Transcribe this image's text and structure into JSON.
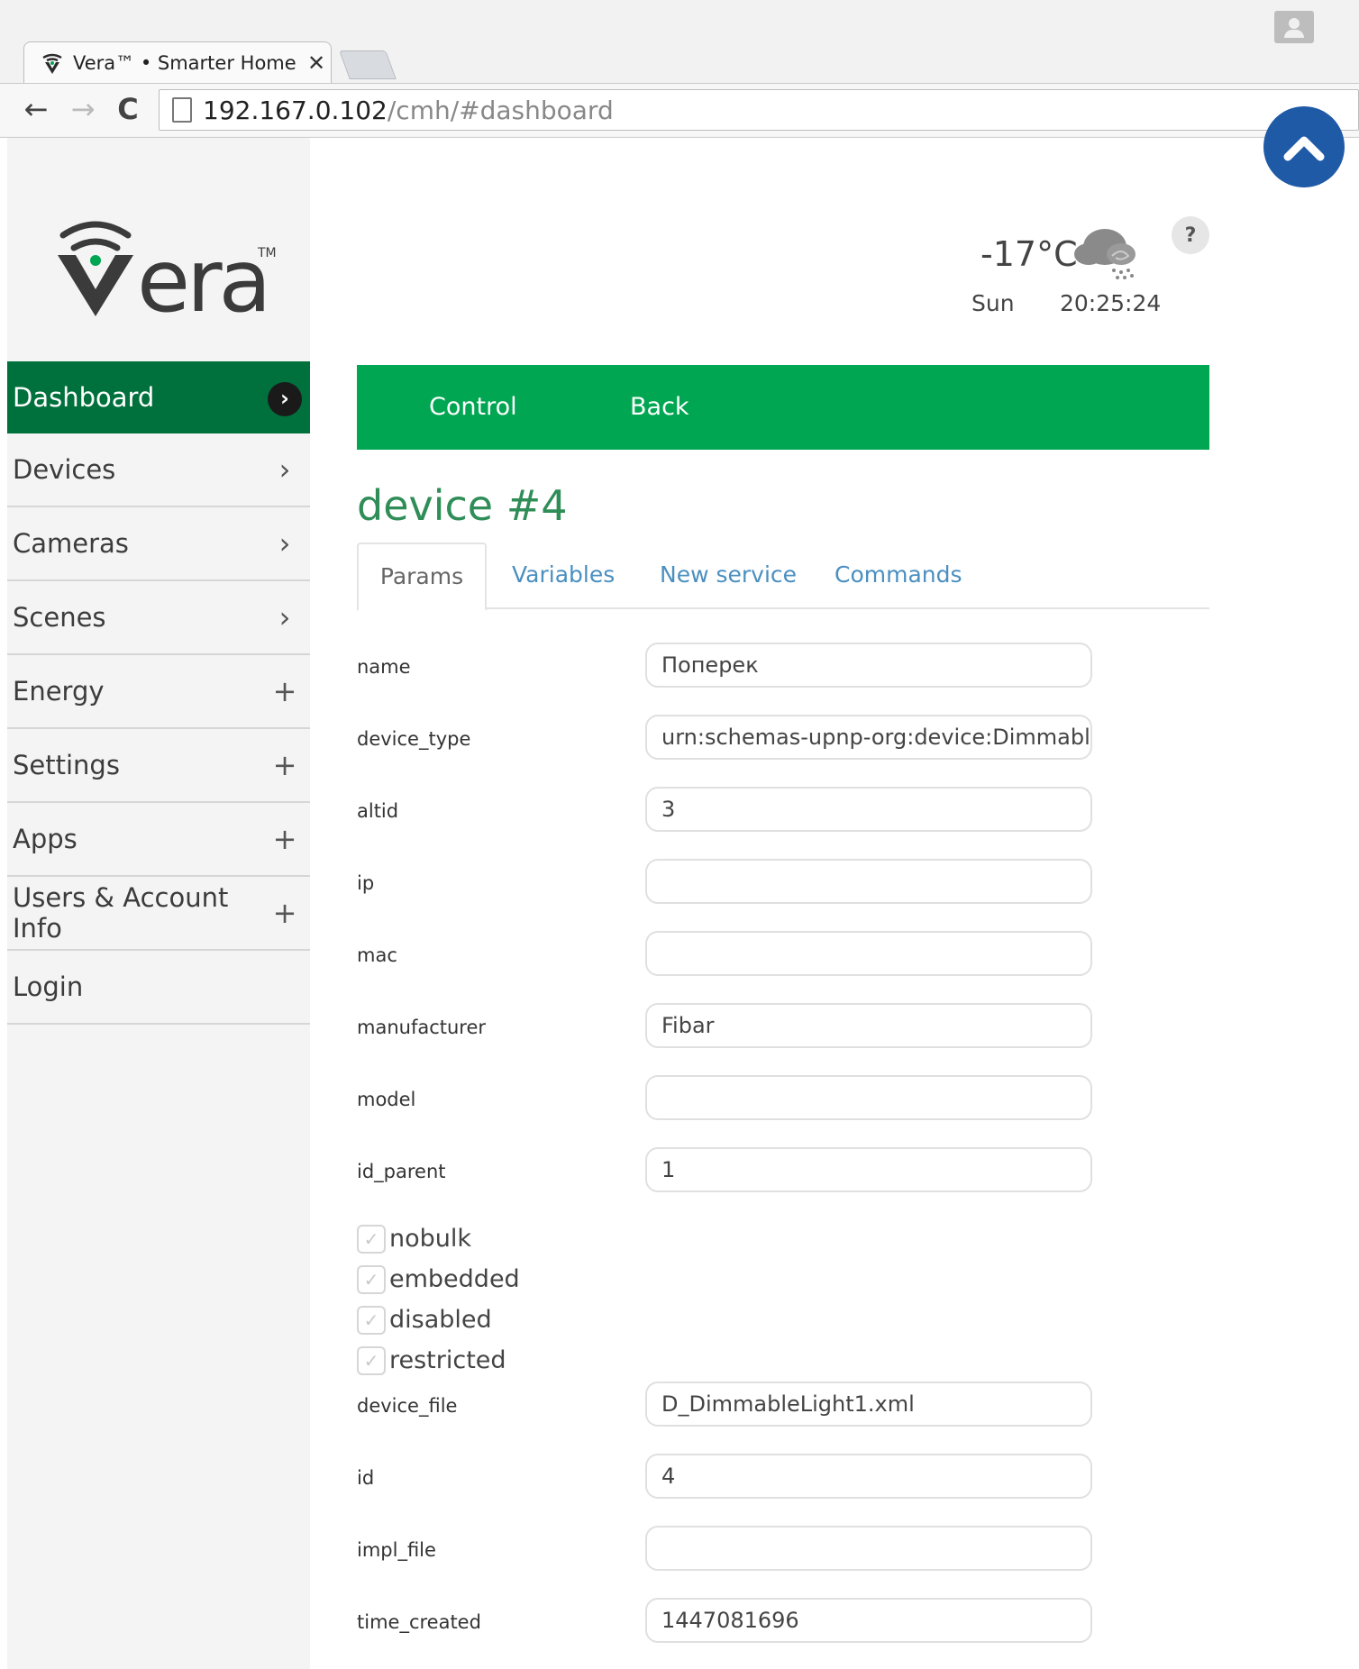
{
  "browser": {
    "tab_title": "Vera™ • Smarter Home C",
    "tab_close": "✕",
    "url_host": "192.167.0.102",
    "url_path": "/cmh/#dashboard"
  },
  "sidebar": {
    "logo_text": "vera",
    "items": [
      {
        "label": "Dashboard",
        "control": "›",
        "icon": "chevron-right-icon",
        "active": true
      },
      {
        "label": "Devices",
        "control": "›",
        "icon": "chevron-right-icon"
      },
      {
        "label": "Cameras",
        "control": "›",
        "icon": "chevron-right-icon"
      },
      {
        "label": "Scenes",
        "control": "›",
        "icon": "chevron-right-icon"
      },
      {
        "label": "Energy",
        "control": "+",
        "icon": "plus-icon"
      },
      {
        "label": "Settings",
        "control": "+",
        "icon": "plus-icon"
      },
      {
        "label": "Apps",
        "control": "+",
        "icon": "plus-icon"
      },
      {
        "label": "Users & Account Info",
        "control": "+",
        "icon": "plus-icon"
      },
      {
        "label": "Login",
        "control": ""
      }
    ]
  },
  "weather": {
    "temperature": "-17°C",
    "day": "Sun",
    "time": "20:25:24",
    "icon": "cloud-snow-icon"
  },
  "help": {
    "label": "?"
  },
  "actions": {
    "control": "Control",
    "back": "Back"
  },
  "device": {
    "title": "device #4"
  },
  "tabs": {
    "params": "Params",
    "variables": "Variables",
    "new_service": "New service",
    "commands": "Commands"
  },
  "params": [
    {
      "label": "name",
      "value": "Поперек"
    },
    {
      "label": "device_type",
      "value": "urn:schemas-upnp-org:device:DimmableLig"
    },
    {
      "label": "altid",
      "value": "3"
    },
    {
      "label": "ip",
      "value": ""
    },
    {
      "label": "mac",
      "value": ""
    },
    {
      "label": "manufacturer",
      "value": "Fibar"
    },
    {
      "label": "model",
      "value": ""
    },
    {
      "label": "id_parent",
      "value": "1"
    }
  ],
  "flags": [
    {
      "label": "nobulk",
      "checked": true
    },
    {
      "label": "embedded",
      "checked": true
    },
    {
      "label": "disabled",
      "checked": true
    },
    {
      "label": "restricted",
      "checked": true
    }
  ],
  "params2": [
    {
      "label": "device_file",
      "value": "D_DimmableLight1.xml"
    },
    {
      "label": "id",
      "value": "4"
    },
    {
      "label": "impl_file",
      "value": ""
    },
    {
      "label": "time_created",
      "value": "1447081696"
    }
  ]
}
